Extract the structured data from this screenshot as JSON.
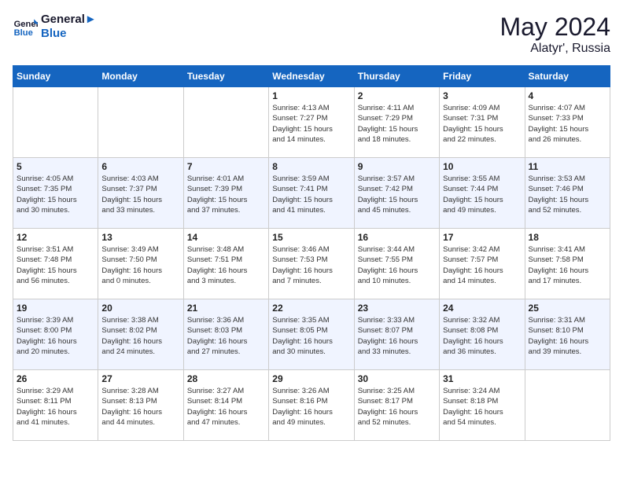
{
  "header": {
    "logo_line1": "General",
    "logo_line2": "Blue",
    "main_title": "May 2024",
    "sub_title": "Alatyr', Russia"
  },
  "weekdays": [
    "Sunday",
    "Monday",
    "Tuesday",
    "Wednesday",
    "Thursday",
    "Friday",
    "Saturday"
  ],
  "weeks": [
    [
      {
        "day": "",
        "text": ""
      },
      {
        "day": "",
        "text": ""
      },
      {
        "day": "",
        "text": ""
      },
      {
        "day": "1",
        "text": "Sunrise: 4:13 AM\nSunset: 7:27 PM\nDaylight: 15 hours\nand 14 minutes."
      },
      {
        "day": "2",
        "text": "Sunrise: 4:11 AM\nSunset: 7:29 PM\nDaylight: 15 hours\nand 18 minutes."
      },
      {
        "day": "3",
        "text": "Sunrise: 4:09 AM\nSunset: 7:31 PM\nDaylight: 15 hours\nand 22 minutes."
      },
      {
        "day": "4",
        "text": "Sunrise: 4:07 AM\nSunset: 7:33 PM\nDaylight: 15 hours\nand 26 minutes."
      }
    ],
    [
      {
        "day": "5",
        "text": "Sunrise: 4:05 AM\nSunset: 7:35 PM\nDaylight: 15 hours\nand 30 minutes."
      },
      {
        "day": "6",
        "text": "Sunrise: 4:03 AM\nSunset: 7:37 PM\nDaylight: 15 hours\nand 33 minutes."
      },
      {
        "day": "7",
        "text": "Sunrise: 4:01 AM\nSunset: 7:39 PM\nDaylight: 15 hours\nand 37 minutes."
      },
      {
        "day": "8",
        "text": "Sunrise: 3:59 AM\nSunset: 7:41 PM\nDaylight: 15 hours\nand 41 minutes."
      },
      {
        "day": "9",
        "text": "Sunrise: 3:57 AM\nSunset: 7:42 PM\nDaylight: 15 hours\nand 45 minutes."
      },
      {
        "day": "10",
        "text": "Sunrise: 3:55 AM\nSunset: 7:44 PM\nDaylight: 15 hours\nand 49 minutes."
      },
      {
        "day": "11",
        "text": "Sunrise: 3:53 AM\nSunset: 7:46 PM\nDaylight: 15 hours\nand 52 minutes."
      }
    ],
    [
      {
        "day": "12",
        "text": "Sunrise: 3:51 AM\nSunset: 7:48 PM\nDaylight: 15 hours\nand 56 minutes."
      },
      {
        "day": "13",
        "text": "Sunrise: 3:49 AM\nSunset: 7:50 PM\nDaylight: 16 hours\nand 0 minutes."
      },
      {
        "day": "14",
        "text": "Sunrise: 3:48 AM\nSunset: 7:51 PM\nDaylight: 16 hours\nand 3 minutes."
      },
      {
        "day": "15",
        "text": "Sunrise: 3:46 AM\nSunset: 7:53 PM\nDaylight: 16 hours\nand 7 minutes."
      },
      {
        "day": "16",
        "text": "Sunrise: 3:44 AM\nSunset: 7:55 PM\nDaylight: 16 hours\nand 10 minutes."
      },
      {
        "day": "17",
        "text": "Sunrise: 3:42 AM\nSunset: 7:57 PM\nDaylight: 16 hours\nand 14 minutes."
      },
      {
        "day": "18",
        "text": "Sunrise: 3:41 AM\nSunset: 7:58 PM\nDaylight: 16 hours\nand 17 minutes."
      }
    ],
    [
      {
        "day": "19",
        "text": "Sunrise: 3:39 AM\nSunset: 8:00 PM\nDaylight: 16 hours\nand 20 minutes."
      },
      {
        "day": "20",
        "text": "Sunrise: 3:38 AM\nSunset: 8:02 PM\nDaylight: 16 hours\nand 24 minutes."
      },
      {
        "day": "21",
        "text": "Sunrise: 3:36 AM\nSunset: 8:03 PM\nDaylight: 16 hours\nand 27 minutes."
      },
      {
        "day": "22",
        "text": "Sunrise: 3:35 AM\nSunset: 8:05 PM\nDaylight: 16 hours\nand 30 minutes."
      },
      {
        "day": "23",
        "text": "Sunrise: 3:33 AM\nSunset: 8:07 PM\nDaylight: 16 hours\nand 33 minutes."
      },
      {
        "day": "24",
        "text": "Sunrise: 3:32 AM\nSunset: 8:08 PM\nDaylight: 16 hours\nand 36 minutes."
      },
      {
        "day": "25",
        "text": "Sunrise: 3:31 AM\nSunset: 8:10 PM\nDaylight: 16 hours\nand 39 minutes."
      }
    ],
    [
      {
        "day": "26",
        "text": "Sunrise: 3:29 AM\nSunset: 8:11 PM\nDaylight: 16 hours\nand 41 minutes."
      },
      {
        "day": "27",
        "text": "Sunrise: 3:28 AM\nSunset: 8:13 PM\nDaylight: 16 hours\nand 44 minutes."
      },
      {
        "day": "28",
        "text": "Sunrise: 3:27 AM\nSunset: 8:14 PM\nDaylight: 16 hours\nand 47 minutes."
      },
      {
        "day": "29",
        "text": "Sunrise: 3:26 AM\nSunset: 8:16 PM\nDaylight: 16 hours\nand 49 minutes."
      },
      {
        "day": "30",
        "text": "Sunrise: 3:25 AM\nSunset: 8:17 PM\nDaylight: 16 hours\nand 52 minutes."
      },
      {
        "day": "31",
        "text": "Sunrise: 3:24 AM\nSunset: 8:18 PM\nDaylight: 16 hours\nand 54 minutes."
      },
      {
        "day": "",
        "text": ""
      }
    ]
  ]
}
